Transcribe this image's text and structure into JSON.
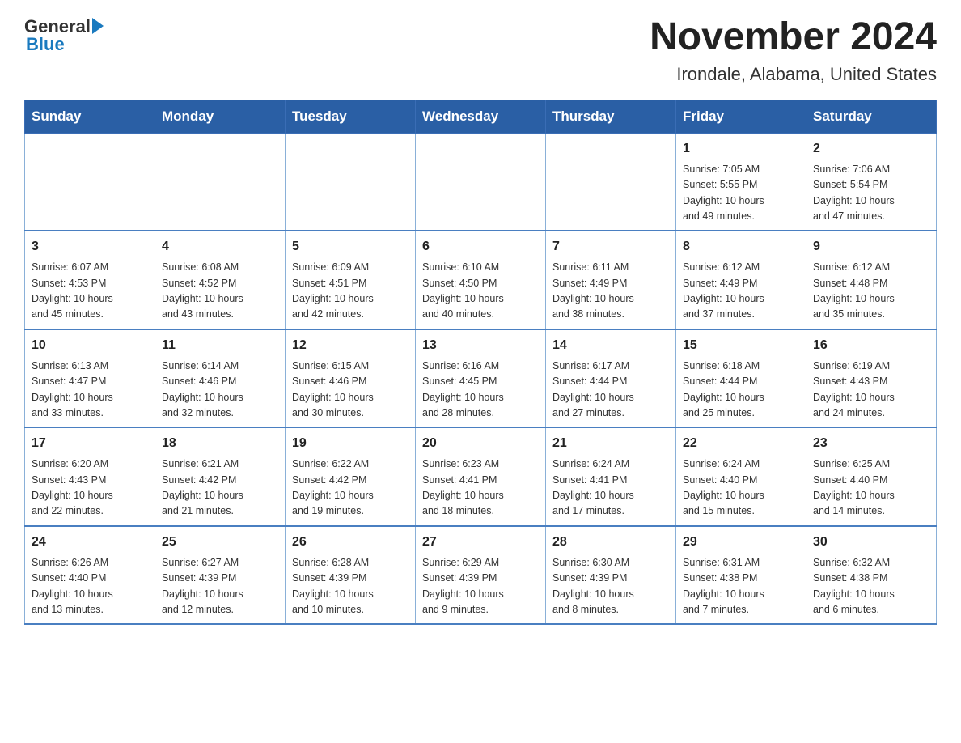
{
  "header": {
    "logo_general": "General",
    "logo_blue": "Blue",
    "month_title": "November 2024",
    "location": "Irondale, Alabama, United States"
  },
  "weekdays": [
    "Sunday",
    "Monday",
    "Tuesday",
    "Wednesday",
    "Thursday",
    "Friday",
    "Saturday"
  ],
  "weeks": [
    [
      {
        "day": "",
        "info": ""
      },
      {
        "day": "",
        "info": ""
      },
      {
        "day": "",
        "info": ""
      },
      {
        "day": "",
        "info": ""
      },
      {
        "day": "",
        "info": ""
      },
      {
        "day": "1",
        "info": "Sunrise: 7:05 AM\nSunset: 5:55 PM\nDaylight: 10 hours\nand 49 minutes."
      },
      {
        "day": "2",
        "info": "Sunrise: 7:06 AM\nSunset: 5:54 PM\nDaylight: 10 hours\nand 47 minutes."
      }
    ],
    [
      {
        "day": "3",
        "info": "Sunrise: 6:07 AM\nSunset: 4:53 PM\nDaylight: 10 hours\nand 45 minutes."
      },
      {
        "day": "4",
        "info": "Sunrise: 6:08 AM\nSunset: 4:52 PM\nDaylight: 10 hours\nand 43 minutes."
      },
      {
        "day": "5",
        "info": "Sunrise: 6:09 AM\nSunset: 4:51 PM\nDaylight: 10 hours\nand 42 minutes."
      },
      {
        "day": "6",
        "info": "Sunrise: 6:10 AM\nSunset: 4:50 PM\nDaylight: 10 hours\nand 40 minutes."
      },
      {
        "day": "7",
        "info": "Sunrise: 6:11 AM\nSunset: 4:49 PM\nDaylight: 10 hours\nand 38 minutes."
      },
      {
        "day": "8",
        "info": "Sunrise: 6:12 AM\nSunset: 4:49 PM\nDaylight: 10 hours\nand 37 minutes."
      },
      {
        "day": "9",
        "info": "Sunrise: 6:12 AM\nSunset: 4:48 PM\nDaylight: 10 hours\nand 35 minutes."
      }
    ],
    [
      {
        "day": "10",
        "info": "Sunrise: 6:13 AM\nSunset: 4:47 PM\nDaylight: 10 hours\nand 33 minutes."
      },
      {
        "day": "11",
        "info": "Sunrise: 6:14 AM\nSunset: 4:46 PM\nDaylight: 10 hours\nand 32 minutes."
      },
      {
        "day": "12",
        "info": "Sunrise: 6:15 AM\nSunset: 4:46 PM\nDaylight: 10 hours\nand 30 minutes."
      },
      {
        "day": "13",
        "info": "Sunrise: 6:16 AM\nSunset: 4:45 PM\nDaylight: 10 hours\nand 28 minutes."
      },
      {
        "day": "14",
        "info": "Sunrise: 6:17 AM\nSunset: 4:44 PM\nDaylight: 10 hours\nand 27 minutes."
      },
      {
        "day": "15",
        "info": "Sunrise: 6:18 AM\nSunset: 4:44 PM\nDaylight: 10 hours\nand 25 minutes."
      },
      {
        "day": "16",
        "info": "Sunrise: 6:19 AM\nSunset: 4:43 PM\nDaylight: 10 hours\nand 24 minutes."
      }
    ],
    [
      {
        "day": "17",
        "info": "Sunrise: 6:20 AM\nSunset: 4:43 PM\nDaylight: 10 hours\nand 22 minutes."
      },
      {
        "day": "18",
        "info": "Sunrise: 6:21 AM\nSunset: 4:42 PM\nDaylight: 10 hours\nand 21 minutes."
      },
      {
        "day": "19",
        "info": "Sunrise: 6:22 AM\nSunset: 4:42 PM\nDaylight: 10 hours\nand 19 minutes."
      },
      {
        "day": "20",
        "info": "Sunrise: 6:23 AM\nSunset: 4:41 PM\nDaylight: 10 hours\nand 18 minutes."
      },
      {
        "day": "21",
        "info": "Sunrise: 6:24 AM\nSunset: 4:41 PM\nDaylight: 10 hours\nand 17 minutes."
      },
      {
        "day": "22",
        "info": "Sunrise: 6:24 AM\nSunset: 4:40 PM\nDaylight: 10 hours\nand 15 minutes."
      },
      {
        "day": "23",
        "info": "Sunrise: 6:25 AM\nSunset: 4:40 PM\nDaylight: 10 hours\nand 14 minutes."
      }
    ],
    [
      {
        "day": "24",
        "info": "Sunrise: 6:26 AM\nSunset: 4:40 PM\nDaylight: 10 hours\nand 13 minutes."
      },
      {
        "day": "25",
        "info": "Sunrise: 6:27 AM\nSunset: 4:39 PM\nDaylight: 10 hours\nand 12 minutes."
      },
      {
        "day": "26",
        "info": "Sunrise: 6:28 AM\nSunset: 4:39 PM\nDaylight: 10 hours\nand 10 minutes."
      },
      {
        "day": "27",
        "info": "Sunrise: 6:29 AM\nSunset: 4:39 PM\nDaylight: 10 hours\nand 9 minutes."
      },
      {
        "day": "28",
        "info": "Sunrise: 6:30 AM\nSunset: 4:39 PM\nDaylight: 10 hours\nand 8 minutes."
      },
      {
        "day": "29",
        "info": "Sunrise: 6:31 AM\nSunset: 4:38 PM\nDaylight: 10 hours\nand 7 minutes."
      },
      {
        "day": "30",
        "info": "Sunrise: 6:32 AM\nSunset: 4:38 PM\nDaylight: 10 hours\nand 6 minutes."
      }
    ]
  ]
}
